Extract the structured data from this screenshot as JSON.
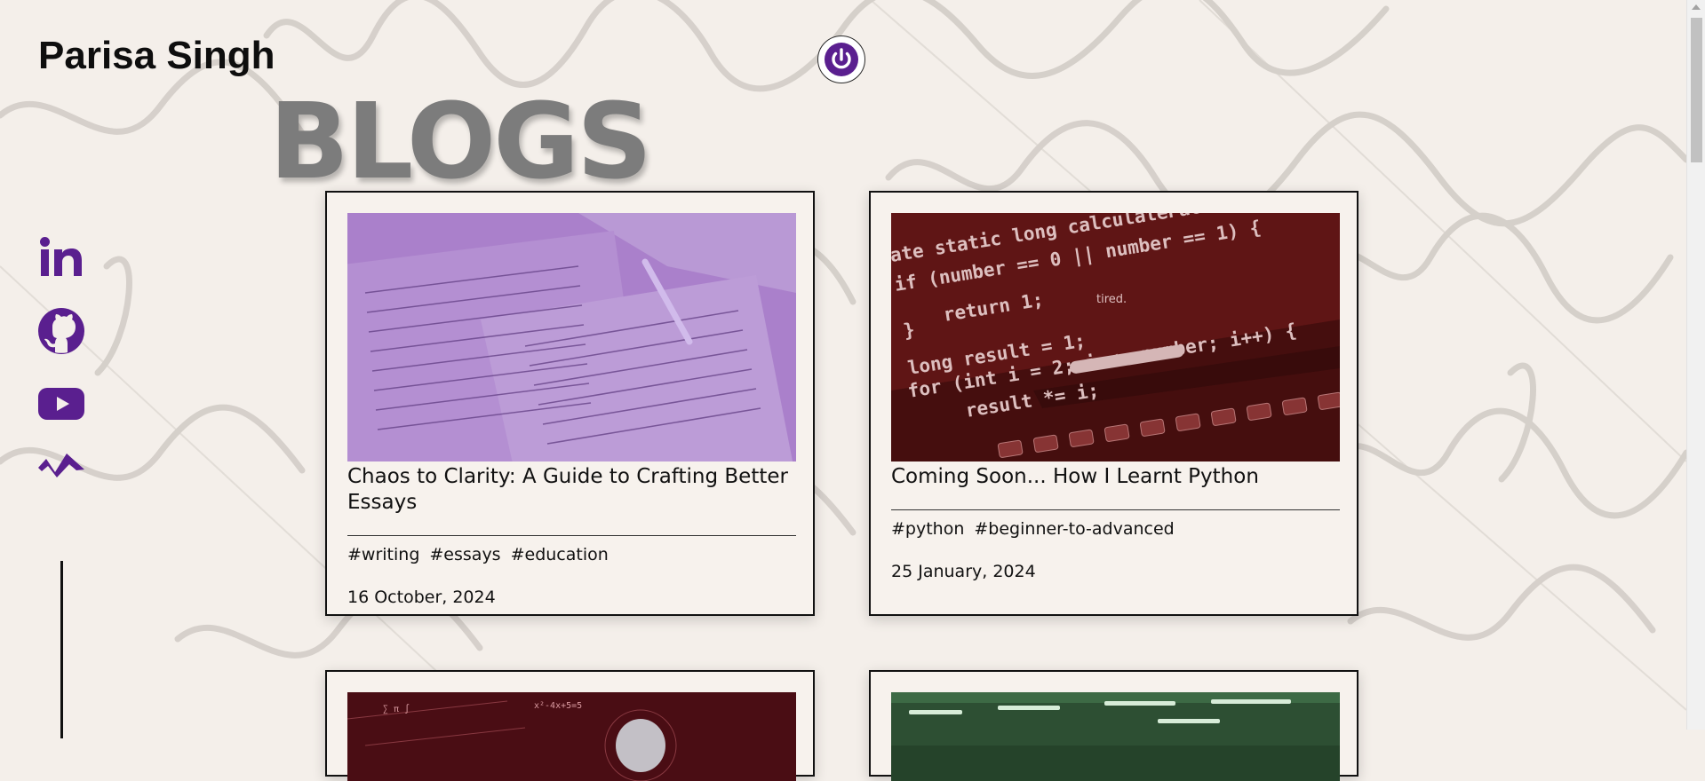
{
  "site": {
    "name": "Parisa Singh"
  },
  "page": {
    "section_title": "BLOGS"
  },
  "theme": {
    "accent": "#5a1f8f",
    "card_border": "#111111",
    "background": "#f4efea"
  },
  "social_links": [
    {
      "name": "linkedin",
      "icon": "linkedin-icon"
    },
    {
      "name": "github",
      "icon": "github-icon"
    },
    {
      "name": "youtube",
      "icon": "youtube-icon"
    },
    {
      "name": "medium",
      "icon": "substack-icon"
    }
  ],
  "posts": [
    {
      "title": "Chaos to Clarity: A Guide to Crafting Better Essays",
      "tags": [
        "#writing",
        "#essays",
        "#education"
      ],
      "date": "16 October, 2024",
      "image": "handwritten-notes"
    },
    {
      "title": "Coming Soon... How I Learnt Python",
      "tags": [
        "#python",
        "#beginner-to-advanced"
      ],
      "date": "25 January, 2024",
      "image": "code-on-laptop",
      "image_text": "tired."
    },
    {
      "title": "",
      "tags": [],
      "date": "",
      "image": "robot-math"
    },
    {
      "title": "",
      "tags": [],
      "date": "",
      "image": "green-office"
    }
  ]
}
